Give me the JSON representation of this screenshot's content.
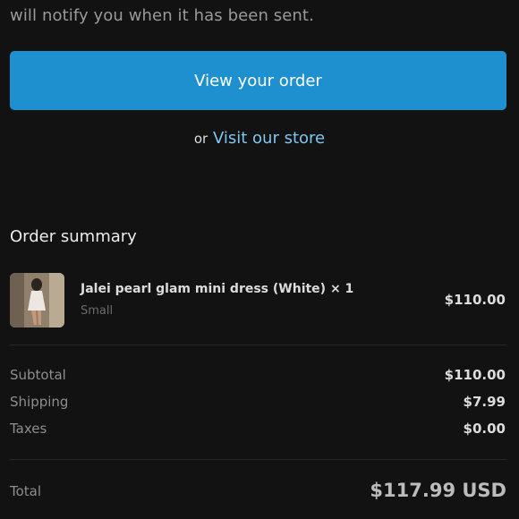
{
  "intro": {
    "text": "will notify you when it has been sent."
  },
  "actions": {
    "view_order_label": "View your order",
    "or_text": "or",
    "visit_store_label": "Visit our store"
  },
  "summary": {
    "title": "Order summary",
    "items": [
      {
        "name": "Jalei pearl glam mini dress (White) × 1",
        "variant": "Small",
        "price": "$110.00"
      }
    ],
    "subtotal_label": "Subtotal",
    "subtotal_value": "$110.00",
    "shipping_label": "Shipping",
    "shipping_value": "$7.99",
    "taxes_label": "Taxes",
    "taxes_value": "$0.00",
    "total_label": "Total",
    "total_value": "$117.99 USD"
  },
  "colors": {
    "background": "#121212",
    "button": "#1f90cf",
    "link": "#7fc6ee"
  }
}
